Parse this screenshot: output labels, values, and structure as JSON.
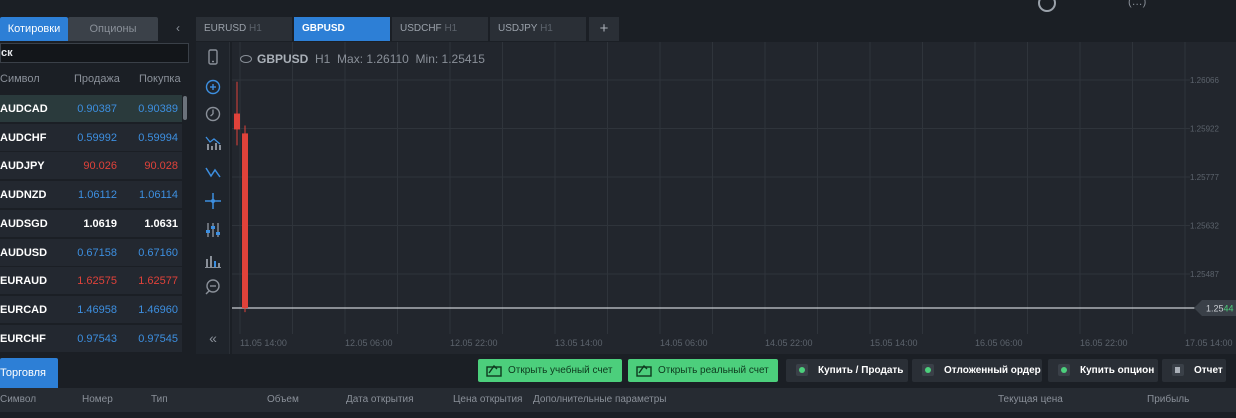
{
  "top": {
    "mini_text": "(…)"
  },
  "left_panel": {
    "tabs": [
      {
        "label": "Котировки"
      },
      {
        "label": "Опционы"
      }
    ],
    "search_value": "ск",
    "columns": {
      "symbol": "Символ",
      "bid": "Продажа",
      "ask": "Покупка"
    },
    "quotes": [
      {
        "symbol": "AUDCAD",
        "bid": "0.90387",
        "ask": "0.90389",
        "color": "blue"
      },
      {
        "symbol": "AUDCHF",
        "bid": "0.59992",
        "ask": "0.59994",
        "color": "blue"
      },
      {
        "symbol": "AUDJPY",
        "bid": "90.026",
        "ask": "90.028",
        "color": "red"
      },
      {
        "symbol": "AUDNZD",
        "bid": "1.06112",
        "ask": "1.06114",
        "color": "blue"
      },
      {
        "symbol": "AUDSGD",
        "bid": "1.0619",
        "ask": "1.0631",
        "color": "white"
      },
      {
        "symbol": "AUDUSD",
        "bid": "0.67158",
        "ask": "0.67160",
        "color": "blue"
      },
      {
        "symbol": "EURAUD",
        "bid": "1.62575",
        "ask": "1.62577",
        "color": "red"
      },
      {
        "symbol": "EURCAD",
        "bid": "1.46958",
        "ask": "1.46960",
        "color": "blue"
      },
      {
        "symbol": "EURCHF",
        "bid": "0.97543",
        "ask": "0.97545",
        "color": "blue"
      }
    ]
  },
  "chart_tabs": [
    {
      "symbol": "EURUSD",
      "tf": "H1"
    },
    {
      "symbol": "GBPUSD",
      "tf": ""
    },
    {
      "symbol": "USDCHF",
      "tf": "H1"
    },
    {
      "symbol": "USDJPY",
      "tf": "H1"
    }
  ],
  "chart_header": {
    "symbol": "GBPUSD",
    "timeframe": "H1",
    "max": "Max: 1.26110",
    "min": "Min: 1.25415"
  },
  "toolbar_icons": [
    "phone-icon",
    "crosshair-circle-icon",
    "clock-icon",
    "indicators-icon",
    "line-tool-icon",
    "crosshair-icon",
    "sliders-icon",
    "volume-bars-icon",
    "zoom-out-icon",
    "collapse-left-icon"
  ],
  "chart_data": {
    "type": "candlestick",
    "title": "GBPUSD H1",
    "ylim": [
      1.2541,
      1.2611
    ],
    "y_ticks": [
      "1.26066",
      "1.25922",
      "1.25777",
      "1.25632",
      "1.25487"
    ],
    "x_ticks": [
      "11.05 14:00",
      "12.05 06:00",
      "12.05 22:00",
      "13.05 14:00",
      "14.05 06:00",
      "14.05 22:00",
      "15.05 14:00",
      "16.05 06:00",
      "16.05 22:00",
      "17.05 14:00"
    ],
    "current_price": {
      "prefix": "1.25",
      "highlight": "44"
    },
    "candles": [
      {
        "open": 1.2595,
        "high": 1.2603,
        "low": 1.2587,
        "close": 1.2591,
        "color": "#e0423a"
      },
      {
        "open": 1.259,
        "high": 1.2592,
        "low": 1.2545,
        "close": 1.2546,
        "color": "#e0423a"
      }
    ],
    "colors": {
      "down": "#e0423a",
      "up": "#4ccf7c",
      "grid": "#2f343b",
      "price_line": "#c9cdd2"
    }
  },
  "trade": {
    "tab_label": "Торговля",
    "buttons": {
      "demo": "Открыть учебный счет",
      "real": "Открыть реальный счет",
      "buy_sell": "Купить / Продать",
      "pending": "Отложенный ордер",
      "option": "Купить опцион",
      "report": "Отчет"
    },
    "columns": {
      "symbol": "Символ",
      "number": "Номер",
      "type": "Тип",
      "volume": "Объем",
      "open_date": "Дата открытия",
      "open_price": "Цена открытия",
      "extra": "Дополнительные параметры",
      "current_price": "Текущая цена",
      "profit": "Прибыль"
    }
  }
}
